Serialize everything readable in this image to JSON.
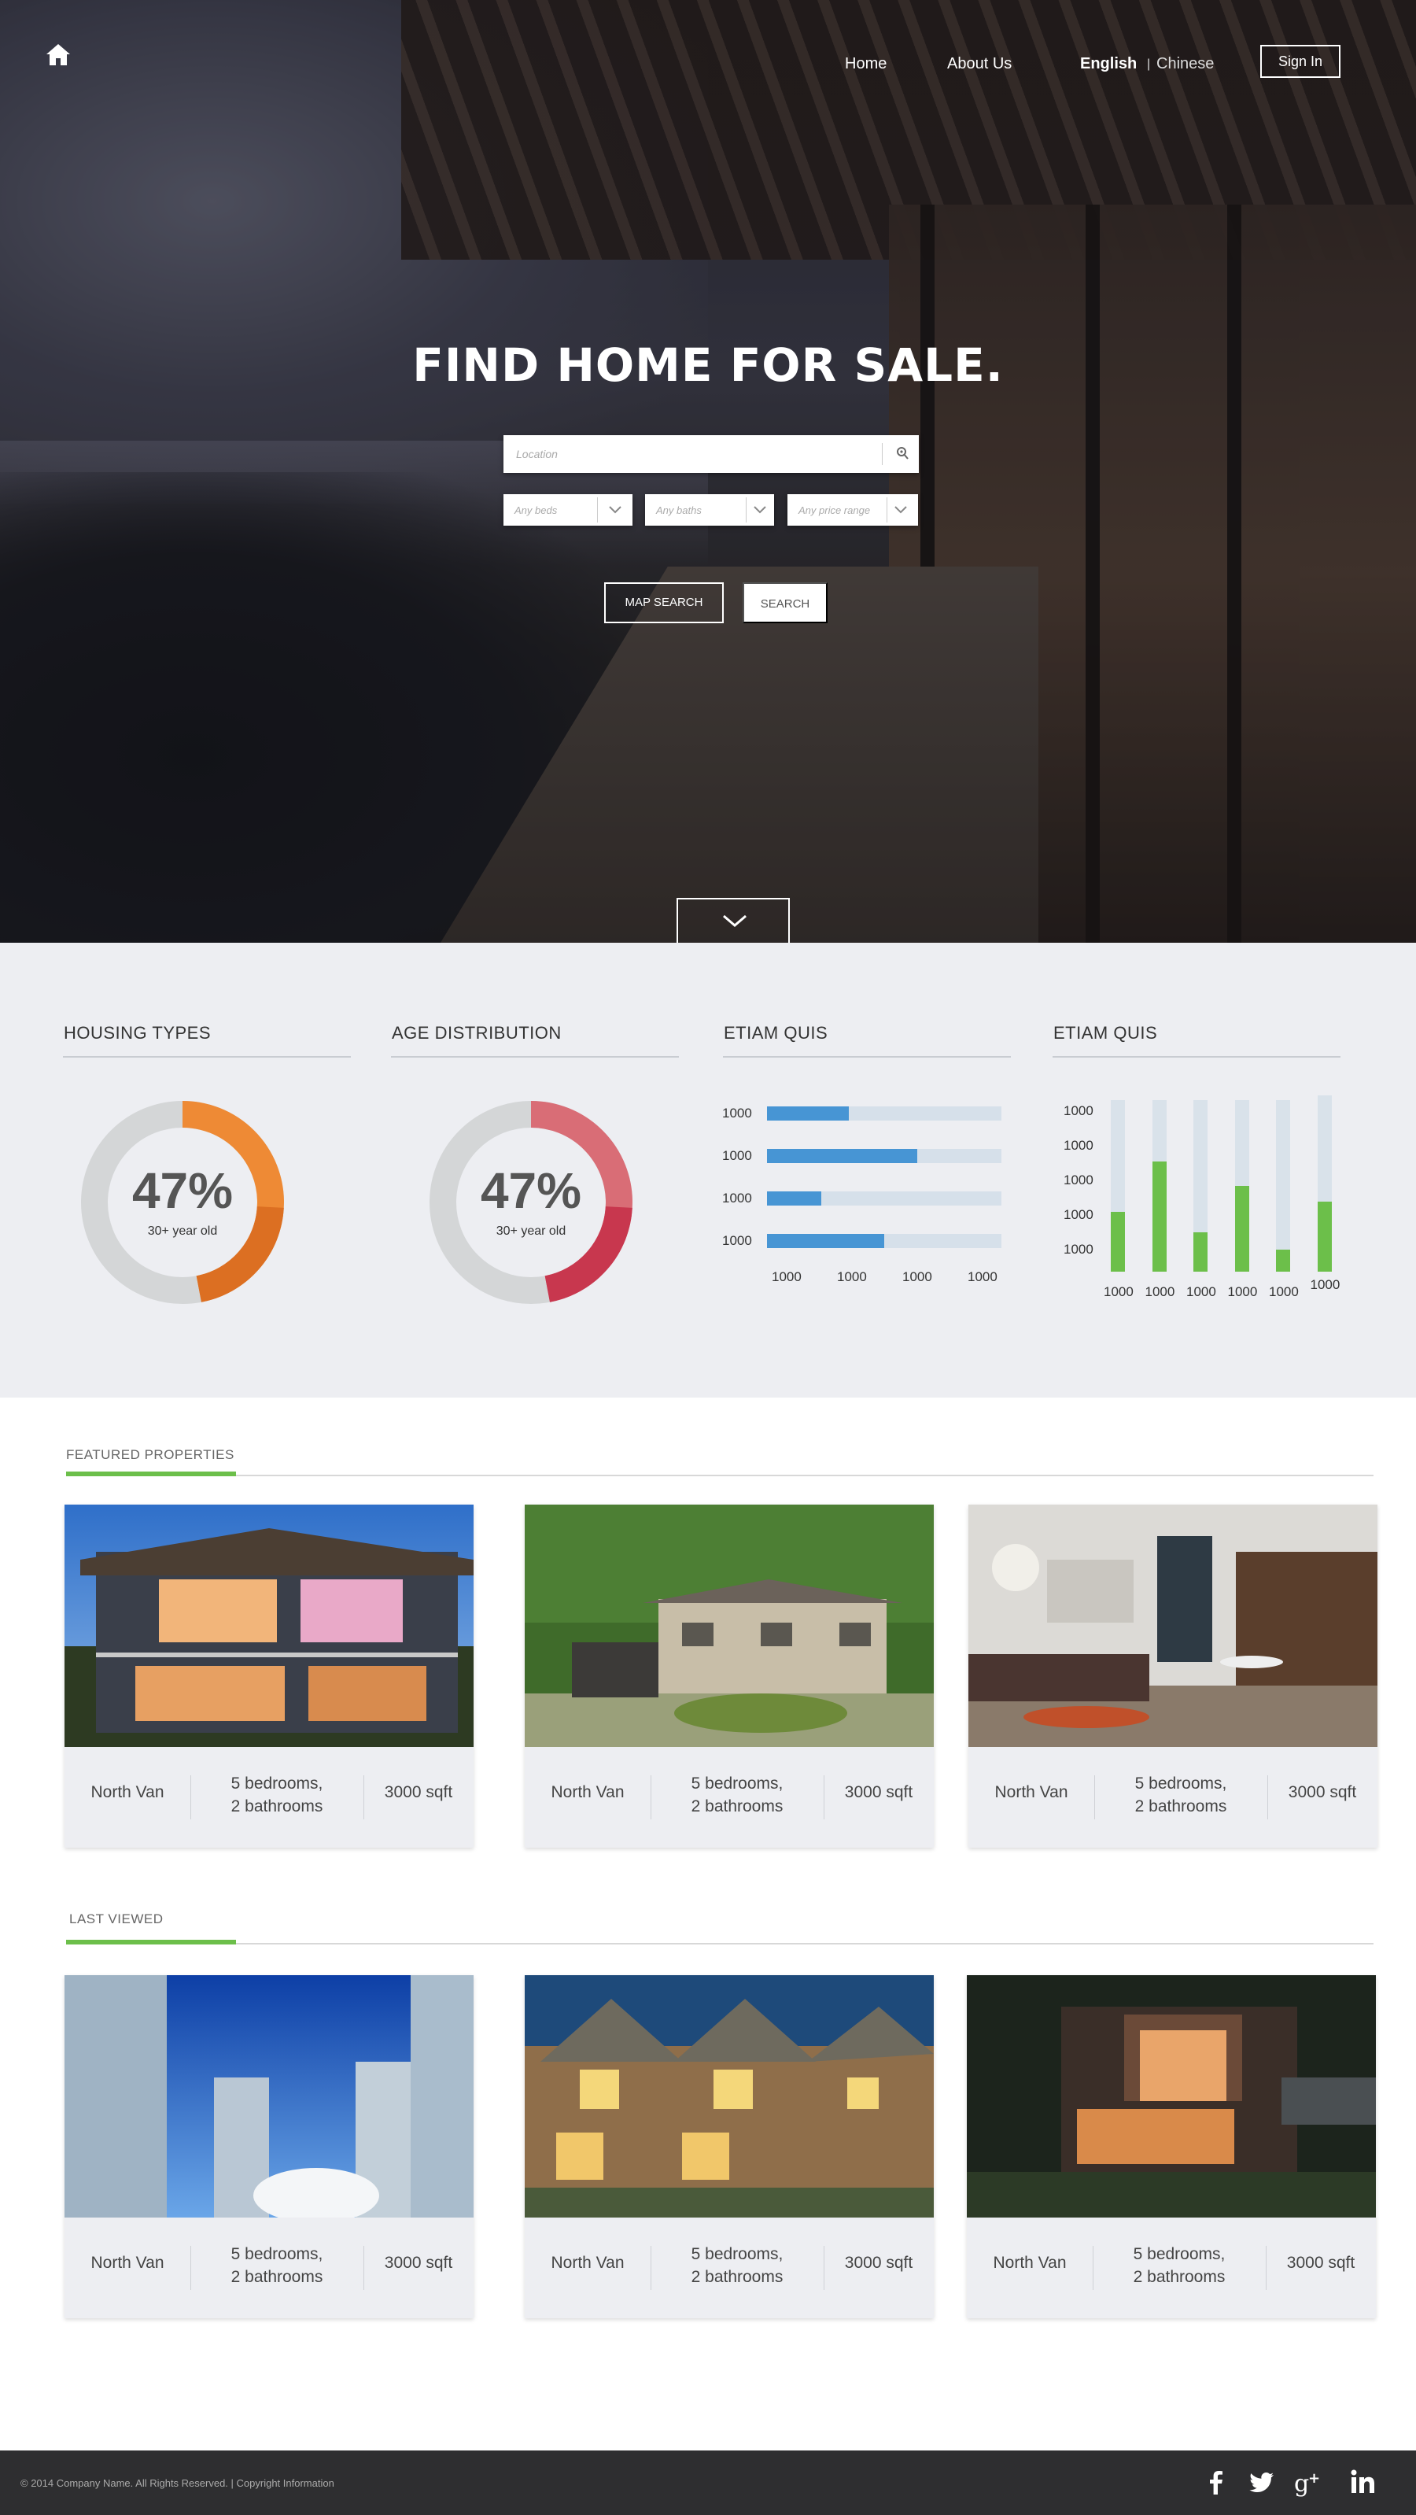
{
  "nav": {
    "home_link": "Home",
    "about_link": "About Us",
    "lang_english": "English",
    "lang_sep": "|",
    "lang_chinese": "Chinese",
    "sign_in": "Sign In"
  },
  "hero": {
    "title": "FIND HOME FOR SALE.",
    "location_placeholder": "Location",
    "beds_placeholder": "Any beds",
    "baths_placeholder": "Any baths",
    "price_placeholder": "Any price range",
    "map_search": "MAP SEARCH",
    "search": "SEARCH"
  },
  "stats": {
    "housing": {
      "title": "HOUSING TYPES",
      "percent": "47%",
      "subtitle": "30+ year old",
      "value": 0.47,
      "color": "#ee8a35"
    },
    "age": {
      "title": "AGE DISTRIBUTION",
      "percent": "47%",
      "subtitle": "30+ year old",
      "value": 0.47,
      "color": "#d96d76"
    },
    "etiam_h": {
      "title": "ETIAM QUIS"
    },
    "etiam_v": {
      "title": "ETIAM QUIS"
    }
  },
  "chart_data": [
    {
      "type": "bar",
      "orientation": "horizontal",
      "title": "ETIAM QUIS",
      "categories": [
        "1000",
        "1000",
        "1000",
        "1000"
      ],
      "values": [
        0.35,
        0.64,
        0.23,
        0.5
      ],
      "x_tick_labels": [
        "1000",
        "1000",
        "1000",
        "1000"
      ],
      "colors": {
        "fill": "#4795d4",
        "track": "#d6e0ea"
      }
    },
    {
      "type": "bar",
      "orientation": "vertical",
      "title": "ETIAM QUIS",
      "categories": [
        "1000",
        "1000",
        "1000",
        "1000",
        "1000",
        "1000"
      ],
      "values": [
        0.35,
        0.64,
        0.23,
        0.5,
        0.13,
        0.41
      ],
      "y_tick_labels": [
        "1000",
        "1000",
        "1000",
        "1000",
        "1000"
      ],
      "colors": {
        "fill": "#6cbf4a",
        "track": "#d9e2ea"
      }
    }
  ],
  "featured": {
    "label": "FEATURED PROPERTIES",
    "cards": [
      {
        "area": "North Van",
        "rooms1": "5 bedrooms,",
        "rooms2": "2 bathrooms",
        "size": "3000 sqft"
      },
      {
        "area": "North Van",
        "rooms1": "5 bedrooms,",
        "rooms2": "2 bathrooms",
        "size": "3000 sqft"
      },
      {
        "area": "North Van",
        "rooms1": "5 bedrooms,",
        "rooms2": "2 bathrooms",
        "size": "3000 sqft"
      }
    ]
  },
  "last_viewed": {
    "label": "LAST VIEWED",
    "cards": [
      {
        "area": "North Van",
        "rooms1": "5 bedrooms,",
        "rooms2": "2 bathrooms",
        "size": "3000 sqft"
      },
      {
        "area": "North Van",
        "rooms1": "5 bedrooms,",
        "rooms2": "2 bathrooms",
        "size": "3000 sqft"
      },
      {
        "area": "North Van",
        "rooms1": "5 bedrooms,",
        "rooms2": "2 bathrooms",
        "size": "3000 sqft"
      }
    ]
  },
  "footer": {
    "copyright": "© 2014 Company Name. All Rights Reserved.  | Copyright Information",
    "social": [
      "facebook-icon",
      "twitter-icon",
      "google-plus-icon",
      "linkedin-icon"
    ]
  },
  "colors": {
    "accent_green": "#6cbf4a",
    "bar_blue": "#4795d4",
    "footer_bg": "#2e2e30",
    "stats_bg": "#edeef2"
  }
}
